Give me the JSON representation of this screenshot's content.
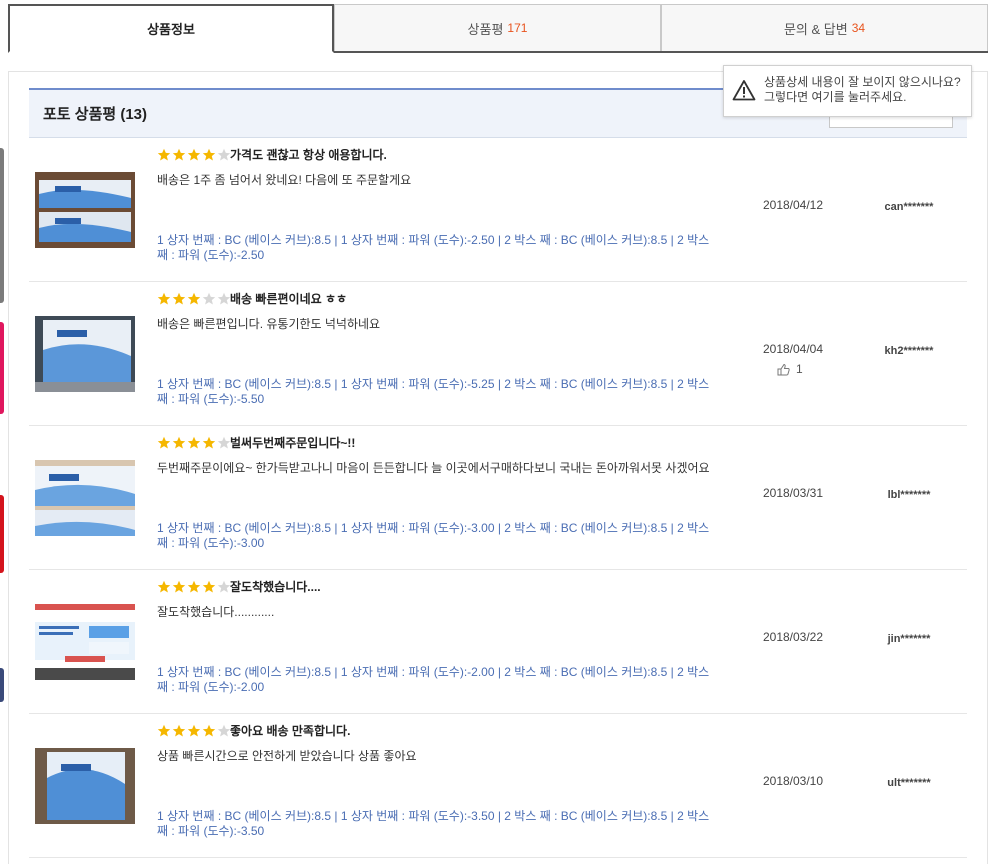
{
  "tabs": [
    {
      "label": "상품정보",
      "count": ""
    },
    {
      "label": "상품평",
      "count": "171"
    },
    {
      "label": "문의 & 답변",
      "count": "34"
    }
  ],
  "photo_reviews": {
    "title": "포토 상품평 (13)"
  },
  "notice": {
    "text": "상품상세 내용이 잘 보이지 않으시나요? 그렇다면 여기를 눌러주세요."
  },
  "reviews": [
    {
      "rating": 4,
      "title": "가격도 괜찮고 항상 애용합니다.",
      "body": "배송은 1주 좀 넘어서 왔네요! 다음에 또 주문할게요",
      "options": "1 상자 번째 : BC (베이스 커브):8.5 | 1 상자 번째 : 파워 (도수):-2.50 | 2 박스 째 : BC (베이스 커브):8.5 | 2 박스 째 : 파워 (도수):-2.50",
      "date": "2018/04/12",
      "likes": "",
      "user": "can*******"
    },
    {
      "rating": 3,
      "title": "배송 빠른편이네요 ㅎㅎ",
      "body": "배송은 빠른편입니다. 유통기한도 넉넉하네요",
      "options": "1 상자 번째 : BC (베이스 커브):8.5 | 1 상자 번째 : 파워 (도수):-5.25 | 2 박스 째 : BC (베이스 커브):8.5 | 2 박스 째 : 파워 (도수):-5.50",
      "date": "2018/04/04",
      "likes": "1",
      "user": "kh2*******"
    },
    {
      "rating": 4,
      "title": "벌써두번째주문입니다~!!",
      "body": "두번째주문이에요~ 한가득받고나니 마음이 든든합니다 늘 이곳에서구매하다보니 국내는 돈아까워서못 사겠어요",
      "options": "1 상자 번째 : BC (베이스 커브):8.5 | 1 상자 번째 : 파워 (도수):-3.00 | 2 박스 째 : BC (베이스 커브):8.5 | 2 박스 째 : 파워 (도수):-3.00",
      "date": "2018/03/31",
      "likes": "",
      "user": "lbl*******"
    },
    {
      "rating": 4,
      "title": "잘도착했습니다....",
      "body": "잘도착했습니다............",
      "options": "1 상자 번째 : BC (베이스 커브):8.5 | 1 상자 번째 : 파워 (도수):-2.00 | 2 박스 째 : BC (베이스 커브):8.5 | 2 박스 째 : 파워 (도수):-2.00",
      "date": "2018/03/22",
      "likes": "",
      "user": "jin*******"
    },
    {
      "rating": 4,
      "title": "좋아요 배송 만족합니다.",
      "body": "상품 빠른시간으로 안전하게 받았습니다 상품 좋아요",
      "options": "1 상자 번째 : BC (베이스 커브):8.5 | 1 상자 번째 : 파워 (도수):-3.50 | 2 박스 째 : BC (베이스 커브):8.5 | 2 박스 째 : 파워 (도수):-3.50",
      "date": "2018/03/10",
      "likes": "",
      "user": "ult*******"
    }
  ],
  "colors": {
    "accent_orange": "#e8541e",
    "star_gold": "#f5b700",
    "option_blue": "#4a6db3",
    "header_bg": "#eff3fa"
  }
}
